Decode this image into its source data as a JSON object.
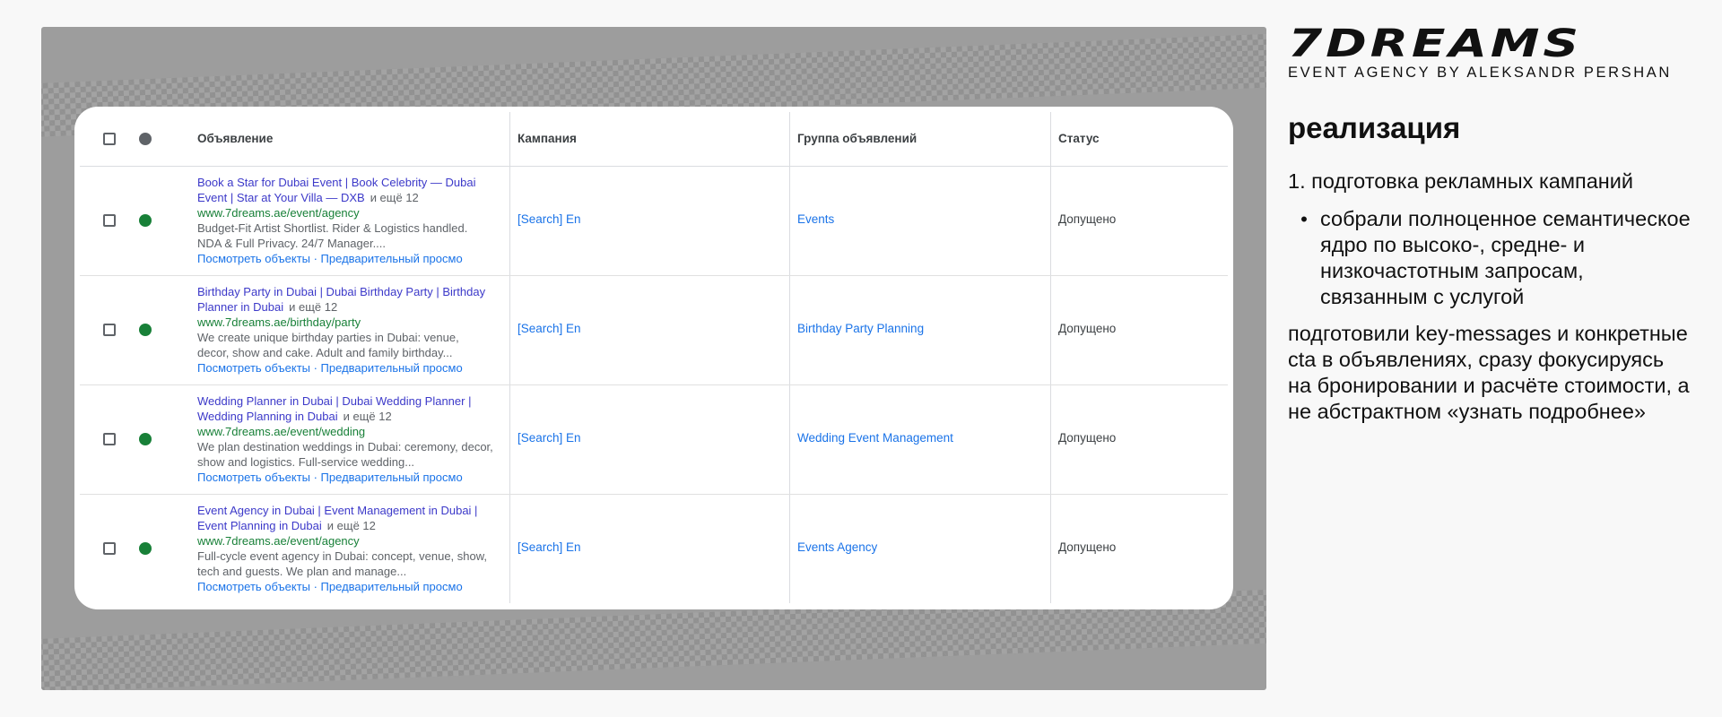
{
  "table": {
    "headers": {
      "ad": "Объявление",
      "campaign": "Кампания",
      "ad_group": "Группа объявлений",
      "status": "Статус"
    },
    "rows": [
      {
        "title": "Book a Star for Dubai Event | Book Celebrity — Dubai Event | Star at Your Villa — DXB",
        "more": "и ещё 12",
        "url": "www.7dreams.ae/event/agency",
        "desc": "Budget-Fit Artist Shortlist. Rider & Logistics handled. NDA & Full Privacy. 24/7 Manager....",
        "links": "Посмотреть объекты · Предварительный просмо",
        "campaign": "[Search] En",
        "ad_group": "Events",
        "status": "Допущено"
      },
      {
        "title": "Birthday Party in Dubai | Dubai Birthday Party | Birthday Planner in Dubai",
        "more": "и ещё 12",
        "url": "www.7dreams.ae/birthday/party",
        "desc": "We create unique birthday parties in Dubai: venue, decor, show and cake. Adult and family birthday...",
        "links": "Посмотреть объекты · Предварительный просмо",
        "campaign": "[Search] En",
        "ad_group": "Birthday Party Planning",
        "status": "Допущено"
      },
      {
        "title": "Wedding Planner in Dubai | Dubai Wedding Planner | Wedding Planning in Dubai",
        "more": "и ещё 12",
        "url": "www.7dreams.ae/event/wedding",
        "desc": "We plan destination weddings in Dubai: ceremony, decor, show and logistics. Full-service wedding...",
        "links": "Посмотреть объекты · Предварительный просмо",
        "campaign": "[Search] En",
        "ad_group": "Wedding Event Management",
        "status": "Допущено"
      },
      {
        "title": "Event Agency in Dubai | Event Management in Dubai | Event Planning in Dubai",
        "more": "и ещё 12",
        "url": "www.7dreams.ae/event/agency",
        "desc": "Full-cycle event agency in Dubai: concept, venue, show, tech and guests. We plan and manage...",
        "links": "Посмотреть объекты · Предварительный просмо",
        "campaign": "[Search] En",
        "ad_group": "Events Agency",
        "status": "Допущено"
      }
    ]
  },
  "brand": {
    "logo": "7DREAMS",
    "tagline": "EVENT AGENCY BY ALEKSANDR PERSHAN"
  },
  "content": {
    "heading": "реализация",
    "item1": "1. подготовка рекламных кампаний",
    "bullet_mark": "•",
    "bullet": "собрали полноценное семантическое ядро по высоко-, средне- и низкочастотным запросам, связанным с услугой",
    "paragraph": "подготовили key-messages и конкретные cta в объявлениях, сразу фокусируясь на бронировании и расчёте стоимости, а не абстрактном «узнать подробнее»"
  },
  "colors": {
    "ad_title": "#3c39c9",
    "url": "#188038",
    "link": "#1a73e8",
    "status_dot": "#188038"
  }
}
